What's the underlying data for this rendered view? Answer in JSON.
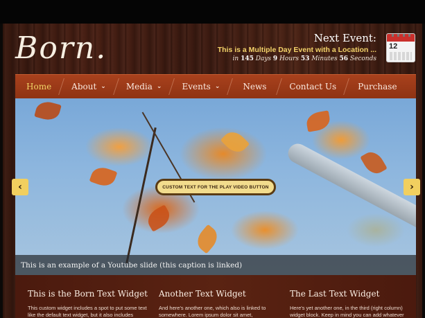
{
  "site": {
    "logo_text": "Born."
  },
  "next_event": {
    "heading": "Next Event:",
    "title": "This is a Multiple Day Event with a Location ...",
    "countdown": {
      "prefix": "in",
      "days": "145",
      "days_label": "Days",
      "hours": "9",
      "hours_label": "Hours",
      "minutes": "53",
      "minutes_label": "Minutes",
      "seconds": "56",
      "seconds_label": "Seconds"
    },
    "calendar_day": "12",
    "icon": "calendar-icon"
  },
  "nav": {
    "items": [
      {
        "label": "Home",
        "dropdown": false,
        "active": true
      },
      {
        "label": "About",
        "dropdown": true,
        "active": false
      },
      {
        "label": "Media",
        "dropdown": true,
        "active": false
      },
      {
        "label": "Events",
        "dropdown": true,
        "active": false
      },
      {
        "label": "News",
        "dropdown": false,
        "active": false
      },
      {
        "label": "Contact Us",
        "dropdown": false,
        "active": false
      },
      {
        "label": "Purchase",
        "dropdown": false,
        "active": false
      }
    ],
    "chevron_glyph": "❯",
    "colors": {
      "bar": "#9a3916",
      "active_text": "#f1d466"
    }
  },
  "slider": {
    "play_button_label": "CUSTOM TEXT FOR THE PLAY VIDEO BUTTON",
    "caption": "This is an example of a Youtube slide (this caption is linked)",
    "prev_arrow": "‹",
    "next_arrow": "›"
  },
  "widgets": [
    {
      "title": "This is the Born Text Widget",
      "text": "This custom widget includes a spot to put some text like the default text widget, but it also includes"
    },
    {
      "title": "Another Text Widget",
      "text": "And here's another one, which also is linked to somewhere. Lorem ipsum dolor sit amet,"
    },
    {
      "title": "The Last Text Widget",
      "text": "Here's yet another one, in the third (right column) widget block. Keep in mind you can add whatever"
    }
  ]
}
